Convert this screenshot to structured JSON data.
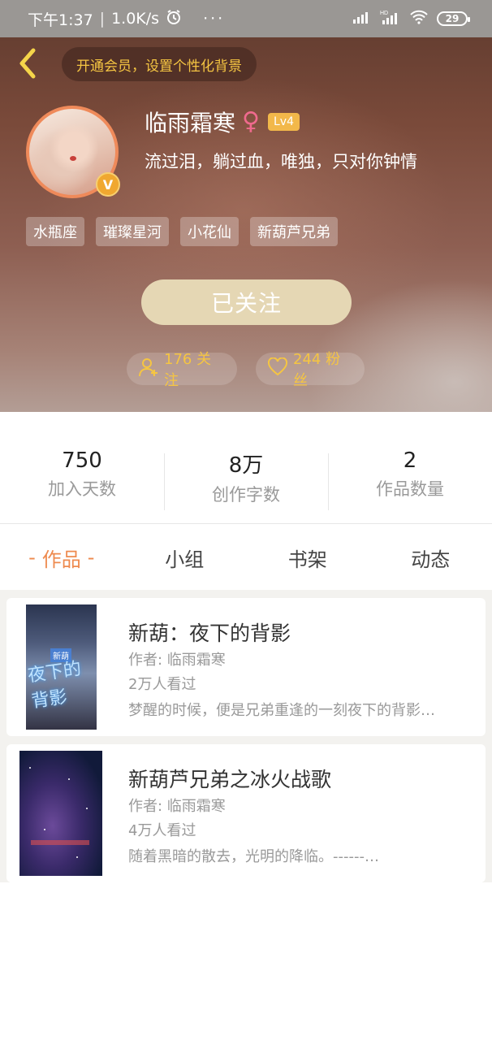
{
  "status_bar": {
    "time": "下午1:37",
    "speed": "1.0K/s",
    "battery": "29"
  },
  "header": {
    "vip_prompt": "开通会员，设置个性化背景",
    "username": "临雨霜寒",
    "gender_symbol": "♀",
    "level": "Lv4",
    "v_badge": "V",
    "signature": "流过泪，躺过血，唯独，只对你钟情",
    "tags": [
      "水瓶座",
      "璀璨星河",
      "小花仙",
      "新葫芦兄弟"
    ],
    "follow_button": "已关注",
    "follows_label": "176 关注",
    "fans_label": "244 粉丝"
  },
  "stats": [
    {
      "value": "750",
      "label": "加入天数"
    },
    {
      "value": "8万",
      "label": "创作字数"
    },
    {
      "value": "2",
      "label": "作品数量"
    }
  ],
  "tabs": {
    "active_dash": "-",
    "items": [
      "作品",
      "小组",
      "书架",
      "动态"
    ]
  },
  "works": [
    {
      "title": "新葫：夜下的背影",
      "author": "作者: 临雨霜寒",
      "views": "2万人看过",
      "desc": "梦醒的时候，便是兄弟重逢的一刻夜下的背影…",
      "cover_text": "夜下的背影",
      "cover_tag": "新葫"
    },
    {
      "title": "新葫芦兄弟之冰火战歌",
      "author": "作者: 临雨霜寒",
      "views": "4万人看过",
      "desc": "随着黑暗的散去，光明的降临。------…"
    }
  ],
  "colors": {
    "accent": "#ee8a4e",
    "gold": "#f5c542",
    "follow_button_bg": "#e5d7b4"
  },
  "icons": {
    "back": "chevron-left-icon",
    "follows": "user-plus-icon",
    "fans": "heart-icon",
    "signal": "signal-icon",
    "wifi": "wifi-icon",
    "alarm": "alarm-icon"
  }
}
